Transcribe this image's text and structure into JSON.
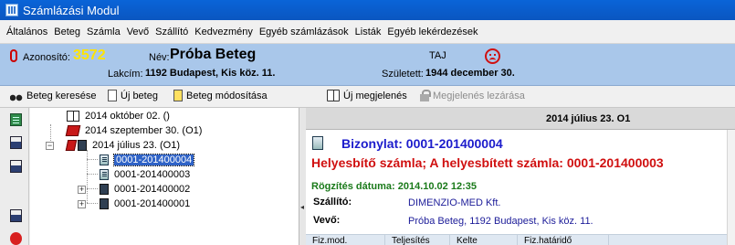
{
  "window": {
    "title": "Számlázási Modul"
  },
  "menu": [
    "Általános",
    "Beteg",
    "Számla",
    "Vevő",
    "Szállító",
    "Kedvezmény",
    "Egyéb számlázások",
    "Listák",
    "Egyéb lekérdezések"
  ],
  "patient": {
    "id_label": "Azonosító:",
    "id_value": "3572",
    "name_label": "Név:",
    "name_value": "Próba Beteg",
    "address_label": "Lakcím:",
    "address_value": "1192 Budapest, Kis köz. 11.",
    "taj_label": "TAJ",
    "born_label": "Született:",
    "born_value": "1944 december 30."
  },
  "toolbar": {
    "search": "Beteg keresése",
    "new_patient": "Új beteg",
    "modify": "Beteg módosítása",
    "new_visit": "Új megjelenés",
    "close_visit": "Megjelenés lezárása"
  },
  "tree": {
    "nodes": [
      {
        "label": "2014 október 02. ()"
      },
      {
        "label": "2014 szeptember 30. (O1)"
      },
      {
        "label": "2014 július 23. (O1)"
      },
      {
        "label": "0001-201400004"
      },
      {
        "label": "0001-201400003"
      },
      {
        "label": "0001-201400002"
      },
      {
        "label": "0001-201400001"
      }
    ]
  },
  "detail": {
    "header": "2014 július 23.  O1",
    "document_title": "Bizonylat: 0001-201400004",
    "correction": "Helyesbítő számla; A helyesbített számla: 0001-201400003",
    "recorded": "Rögzítés dátuma: 2014.10.02 12:35",
    "supplier_label": "Szállító:",
    "supplier_value": "DIMENZIO-MED Kft.",
    "buyer_label": "Vevő:",
    "buyer_value": "Próba Beteg, 1192 Budapest, Kis köz. 11.",
    "columns": [
      "Fiz.mod.",
      "Teljesítés",
      "Kelte",
      "Fiz.határidő"
    ]
  }
}
